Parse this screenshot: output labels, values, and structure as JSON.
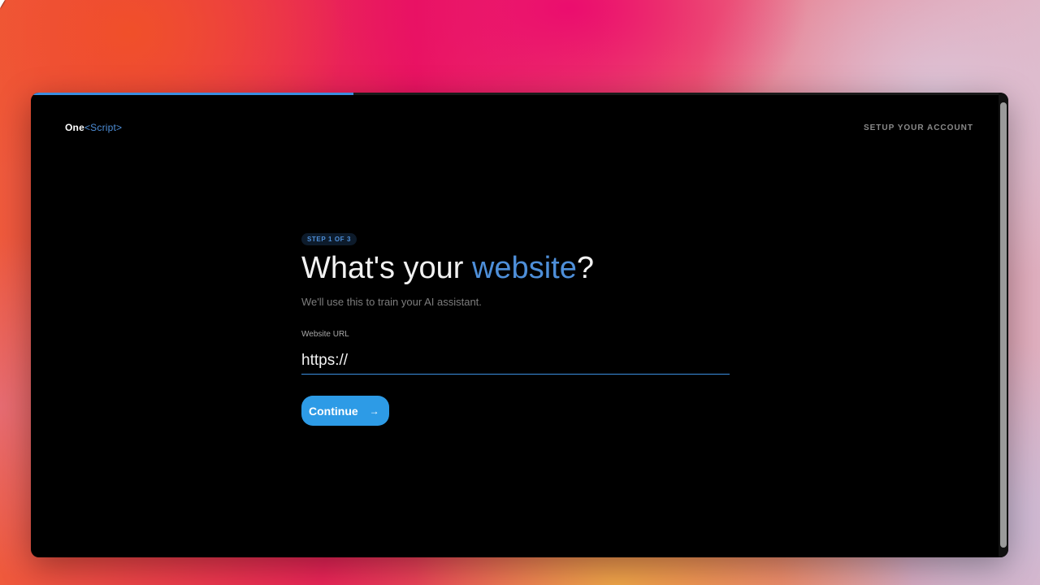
{
  "progress": {
    "value": 0.333
  },
  "header": {
    "logo_main": "One",
    "logo_accent": "<Script>",
    "setup_label": "SETUP YOUR ACCOUNT"
  },
  "step": {
    "badge": "STEP 1 OF 3",
    "title_prefix": "What's your ",
    "title_highlight": "website",
    "title_suffix": "?",
    "subtitle": "We'll use this to train your AI assistant."
  },
  "form": {
    "url_label": "Website URL",
    "url_value": "https://",
    "continue_label": "Continue",
    "continue_icon": "arrow-right-icon"
  },
  "colors": {
    "accent": "#4e8fd9",
    "button": "#2d9be6",
    "window_bg": "#000000"
  }
}
